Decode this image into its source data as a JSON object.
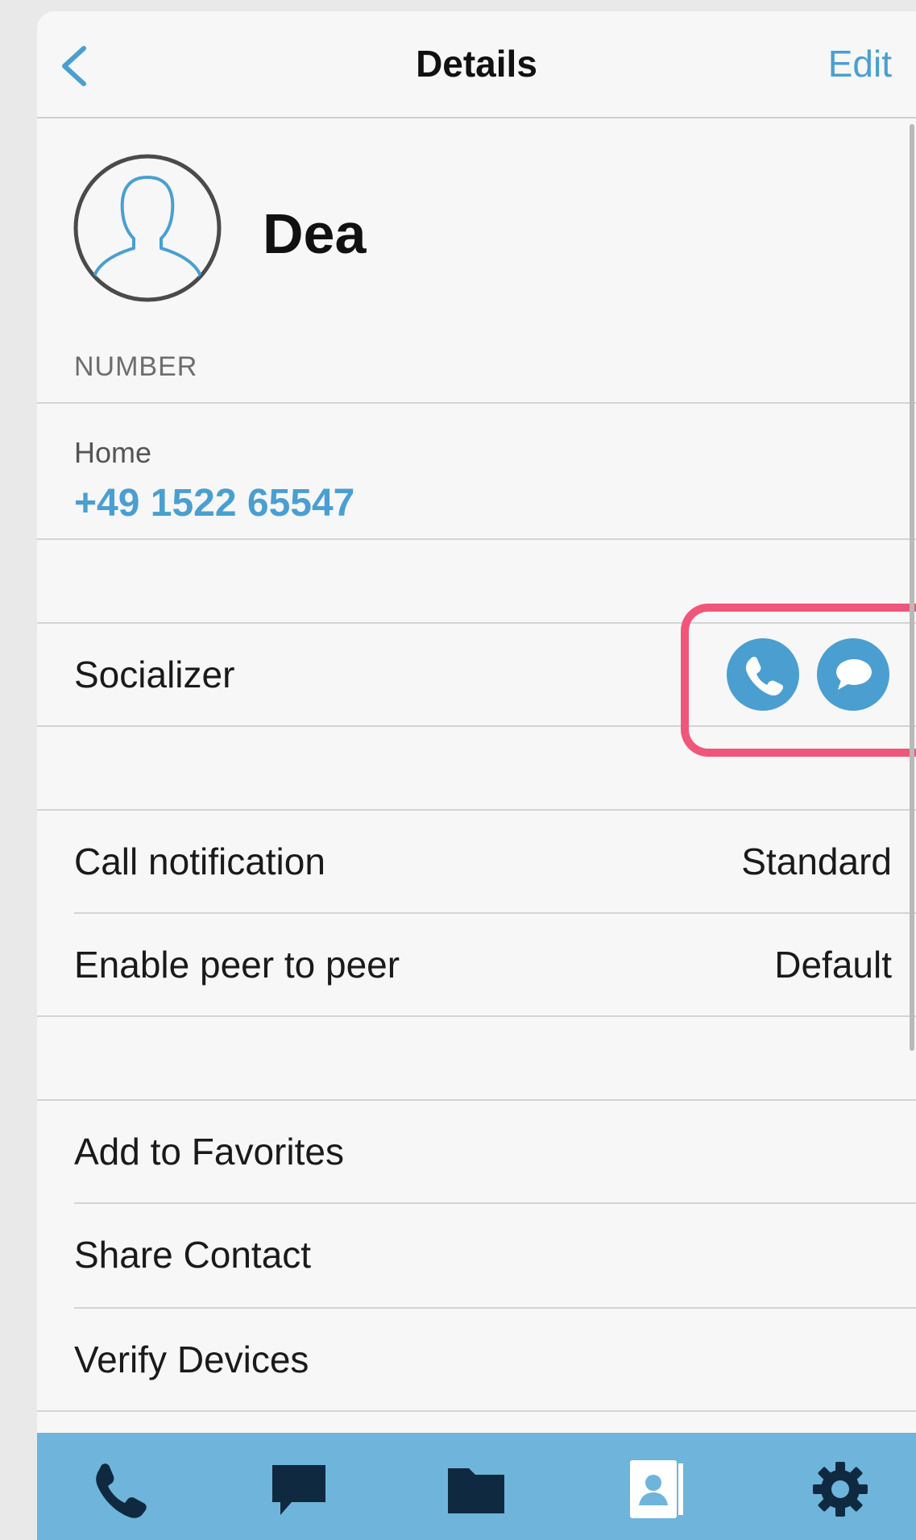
{
  "navbar": {
    "title": "Details",
    "edit_label": "Edit"
  },
  "contact": {
    "name": "Dea",
    "section_label": "NUMBER",
    "number_type": "Home",
    "number_value": "+49 1522 65547"
  },
  "socializer": {
    "label": "Socializer"
  },
  "settings": [
    {
      "label": "Call notification",
      "value": "Standard"
    },
    {
      "label": "Enable peer to peer",
      "value": "Default"
    }
  ],
  "actions": [
    {
      "label": "Add to Favorites"
    },
    {
      "label": "Share Contact"
    },
    {
      "label": "Verify Devices"
    }
  ],
  "tabbar": {
    "tabs": [
      "phone-icon",
      "chat-icon",
      "folder-icon",
      "contacts-icon",
      "settings-gear-icon"
    ]
  },
  "colors": {
    "accent": "#4a9fd0",
    "tabbar": "#6fb4da",
    "highlight": "#f0567a"
  }
}
